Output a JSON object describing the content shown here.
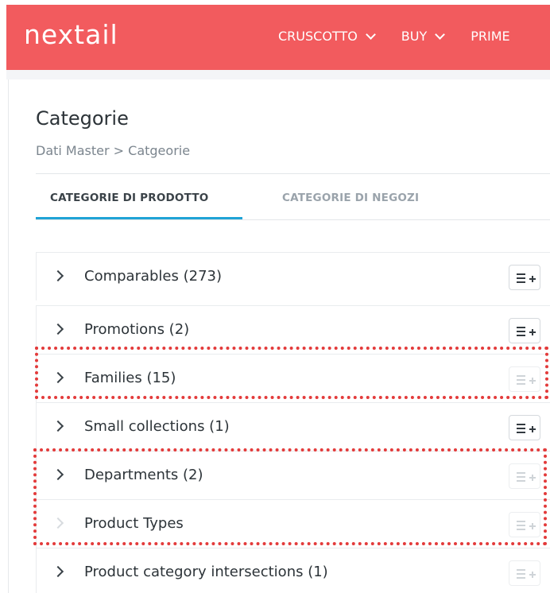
{
  "header": {
    "logo": "nextail",
    "nav": [
      {
        "label": "CRUSCOTTO"
      },
      {
        "label": "BUY"
      },
      {
        "label": "PRIME"
      }
    ]
  },
  "page": {
    "title": "Categorie",
    "breadcrumb": "Dati Master > Catgeorie"
  },
  "tabs": [
    {
      "label": "CATEGORIE DI PRODOTTO",
      "active": true
    },
    {
      "label": "CATEGORIE DI NEGOZI",
      "active": false
    }
  ],
  "categories": [
    {
      "label": "Comparables (273)",
      "expandable": true,
      "add_enabled": true
    },
    {
      "label": "Promotions (2)",
      "expandable": true,
      "add_enabled": true
    },
    {
      "label": "Families (15)",
      "expandable": true,
      "add_enabled": false
    },
    {
      "label": "Small collections (1)",
      "expandable": true,
      "add_enabled": true
    },
    {
      "label": "Departments (2)",
      "expandable": true,
      "add_enabled": false
    },
    {
      "label": "Product Types",
      "expandable": false,
      "add_enabled": false
    },
    {
      "label": "Product category intersections (1)",
      "expandable": true,
      "add_enabled": false
    }
  ],
  "annotations": {
    "highlight_color": "#e33b3b"
  },
  "colors": {
    "brand": "#f25b5e",
    "tab_accent": "#1fa3d6"
  }
}
